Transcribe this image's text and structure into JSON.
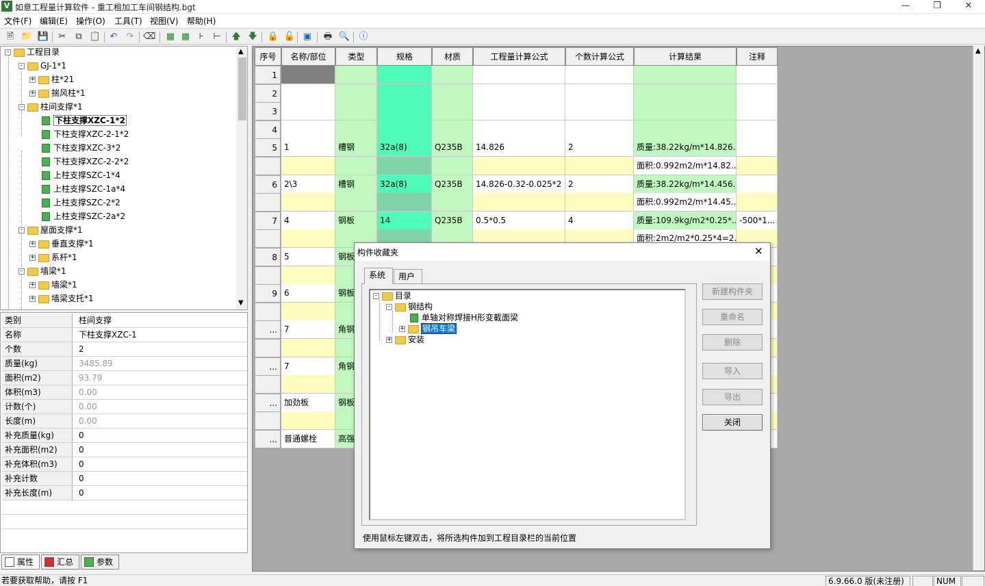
{
  "window": {
    "title": "如意工程量计算软件 - 重工租加工车间钢结构.bgt",
    "app_icon": "app-logo-icon"
  },
  "menu": [
    "文件(F)",
    "编辑(E)",
    "操作(O)",
    "工具(T)",
    "视图(V)",
    "帮助(H)"
  ],
  "tree": {
    "nodes": [
      {
        "label": "工程目录",
        "expander": "-"
      },
      {
        "label": "GJ-1*1",
        "expander": "-"
      },
      {
        "label": "柱*21",
        "expander": "+"
      },
      {
        "label": "揣风柱*1",
        "expander": "+"
      },
      {
        "label": "柱间支撑*1",
        "expander": "-"
      },
      {
        "label": "下柱支撑XZC-1*2",
        "selected": true
      },
      {
        "label": "下柱支撑XZC-2-1*2"
      },
      {
        "label": "下柱支撑XZC-3*2"
      },
      {
        "label": "下柱支撑XZC-2-2*2"
      },
      {
        "label": "上柱支撑SZC-1*4"
      },
      {
        "label": "上柱支撑SZC-1a*4"
      },
      {
        "label": "上柱支撑SZC-2*2"
      },
      {
        "label": "上柱支撑SZC-2a*2"
      },
      {
        "label": "屋面支撑*1",
        "expander": "-"
      },
      {
        "label": "垂直支撑*1",
        "expander": "+"
      },
      {
        "label": "系杆*1",
        "expander": "+"
      },
      {
        "label": "墙梁*1",
        "expander": "-"
      },
      {
        "label": "墙梁*1",
        "expander": "+"
      },
      {
        "label": "墙梁支托*1",
        "expander": "+"
      }
    ]
  },
  "props": {
    "rows": [
      {
        "k": "类别",
        "v": "柱间支撑",
        "dis": false
      },
      {
        "k": "名称",
        "v": "下柱支撑XZC-1",
        "dis": false
      },
      {
        "k": "个数",
        "v": "2",
        "dis": false
      },
      {
        "k": "质量(kg)",
        "v": "3485.89",
        "dis": true
      },
      {
        "k": "面积(m2)",
        "v": "93.79",
        "dis": true
      },
      {
        "k": "体积(m3)",
        "v": "0.00",
        "dis": true
      },
      {
        "k": "计数(个)",
        "v": "0.00",
        "dis": true
      },
      {
        "k": "长度(m)",
        "v": "0.00",
        "dis": true
      },
      {
        "k": "补充质量(kg)",
        "v": "0",
        "dis": false
      },
      {
        "k": "补充面积(m2)",
        "v": "0",
        "dis": false
      },
      {
        "k": "补充体积(m3)",
        "v": "0",
        "dis": false
      },
      {
        "k": "补充计数",
        "v": "0",
        "dis": false
      },
      {
        "k": "补充长度(m)",
        "v": "0",
        "dis": false
      }
    ],
    "tabs": [
      "属性",
      "汇总",
      "参数"
    ]
  },
  "grid": {
    "headers": [
      "序号",
      "名称/部位",
      "类型",
      "规格",
      "材质",
      "工程量计算公式",
      "个数计算公式",
      "计算结果",
      "注释"
    ],
    "rows": [
      {
        "n": "1",
        "cells": [
          "",
          "",
          "",
          "",
          "",
          "",
          "",
          ""
        ]
      },
      {
        "n": "2",
        "cells": [
          "",
          "",
          "",
          "",
          "",
          "",
          "",
          ""
        ]
      },
      {
        "n": "3",
        "cells": [
          "",
          "",
          "",
          "",
          "",
          "",
          "",
          ""
        ]
      },
      {
        "n": "4",
        "cells": [
          "",
          "",
          "",
          "",
          "",
          "",
          "",
          ""
        ]
      },
      {
        "n": "5",
        "cells": [
          "1",
          "槽钢",
          "32a(8)",
          "Q235B",
          "14.826",
          "2",
          "质量:38.22kg/m*14.826...",
          ""
        ]
      },
      {
        "n": "",
        "cells": [
          "",
          "",
          "",
          "",
          "",
          "",
          "面积:0.992m2/m*14.82...",
          ""
        ]
      },
      {
        "n": "6",
        "cells": [
          "2\\3",
          "槽钢",
          "32a(8)",
          "Q235B",
          "14.826-0.32-0.025*2",
          "2",
          "质量:38.22kg/m*14.456...",
          ""
        ]
      },
      {
        "n": "",
        "cells": [
          "",
          "",
          "",
          "",
          "",
          "",
          "面积:0.992m2/m*14.45...",
          ""
        ]
      },
      {
        "n": "7",
        "cells": [
          "4",
          "钢板",
          "14",
          "Q235B",
          "0.5*0.5",
          "4",
          "质量:109.9kg/m2*0.25*...",
          "-500*1..."
        ]
      },
      {
        "n": "",
        "cells": [
          "",
          "",
          "",
          "",
          "",
          "",
          "面积:2m2/m2*0.25*4=2...",
          ""
        ]
      },
      {
        "n": "8",
        "cells": [
          "5",
          "钢板",
          "",
          "",
          "",
          "",
          "",
          ""
        ]
      },
      {
        "n": "",
        "cells": [
          "",
          "",
          "",
          "",
          "",
          "",
          "",
          ""
        ]
      },
      {
        "n": "9",
        "cells": [
          "6",
          "钢板",
          "",
          "",
          "",
          "",
          "",
          ""
        ]
      },
      {
        "n": "",
        "cells": [
          "",
          "",
          "",
          "",
          "",
          "",
          "",
          ""
        ]
      },
      {
        "n": "...",
        "cells": [
          "7",
          "角钢",
          "",
          "",
          "",
          "",
          "",
          ""
        ]
      },
      {
        "n": "",
        "cells": [
          "",
          "",
          "",
          "",
          "",
          "",
          "",
          ""
        ]
      },
      {
        "n": "...",
        "cells": [
          "7",
          "角钢",
          "",
          "",
          "",
          "",
          "",
          ""
        ]
      },
      {
        "n": "",
        "cells": [
          "",
          "",
          "",
          "",
          "",
          "",
          "",
          ""
        ]
      },
      {
        "n": "...",
        "cells": [
          "加劲板",
          "钢板",
          "",
          "",
          "",
          "",
          "",
          ""
        ]
      },
      {
        "n": "",
        "cells": [
          "",
          "",
          "",
          "",
          "",
          "",
          "",
          ""
        ]
      },
      {
        "n": "...",
        "cells": [
          "普通螺栓",
          "高强",
          "",
          "",
          "",
          "",
          "",
          ""
        ]
      }
    ]
  },
  "dialog": {
    "title": "构件收藏夹",
    "tabs": [
      "系统",
      "用户"
    ],
    "tree": {
      "root": "目录",
      "steel": "钢结构",
      "item1": "单轴对称焊接H形变截面梁",
      "item2": "钢吊车梁",
      "install": "安装"
    },
    "buttons": {
      "new": "新建构件夹",
      "rename": "重命名",
      "delete": "删除",
      "import": "导入",
      "export": "导出",
      "close": "关闭"
    },
    "hint": "使用鼠标左键双击，将所选构件加到工程目录栏的当前位置"
  },
  "status": {
    "help": "若要获取帮助，请按 F1",
    "version": "6.9.66.0 版(未注册)",
    "num": "NUM"
  },
  "colors": {
    "green_light": "#c0f8c0",
    "green_teal": "#4cfcb8",
    "yellow_light": "#fffcc0",
    "green_dark": "#7fd4a8"
  }
}
